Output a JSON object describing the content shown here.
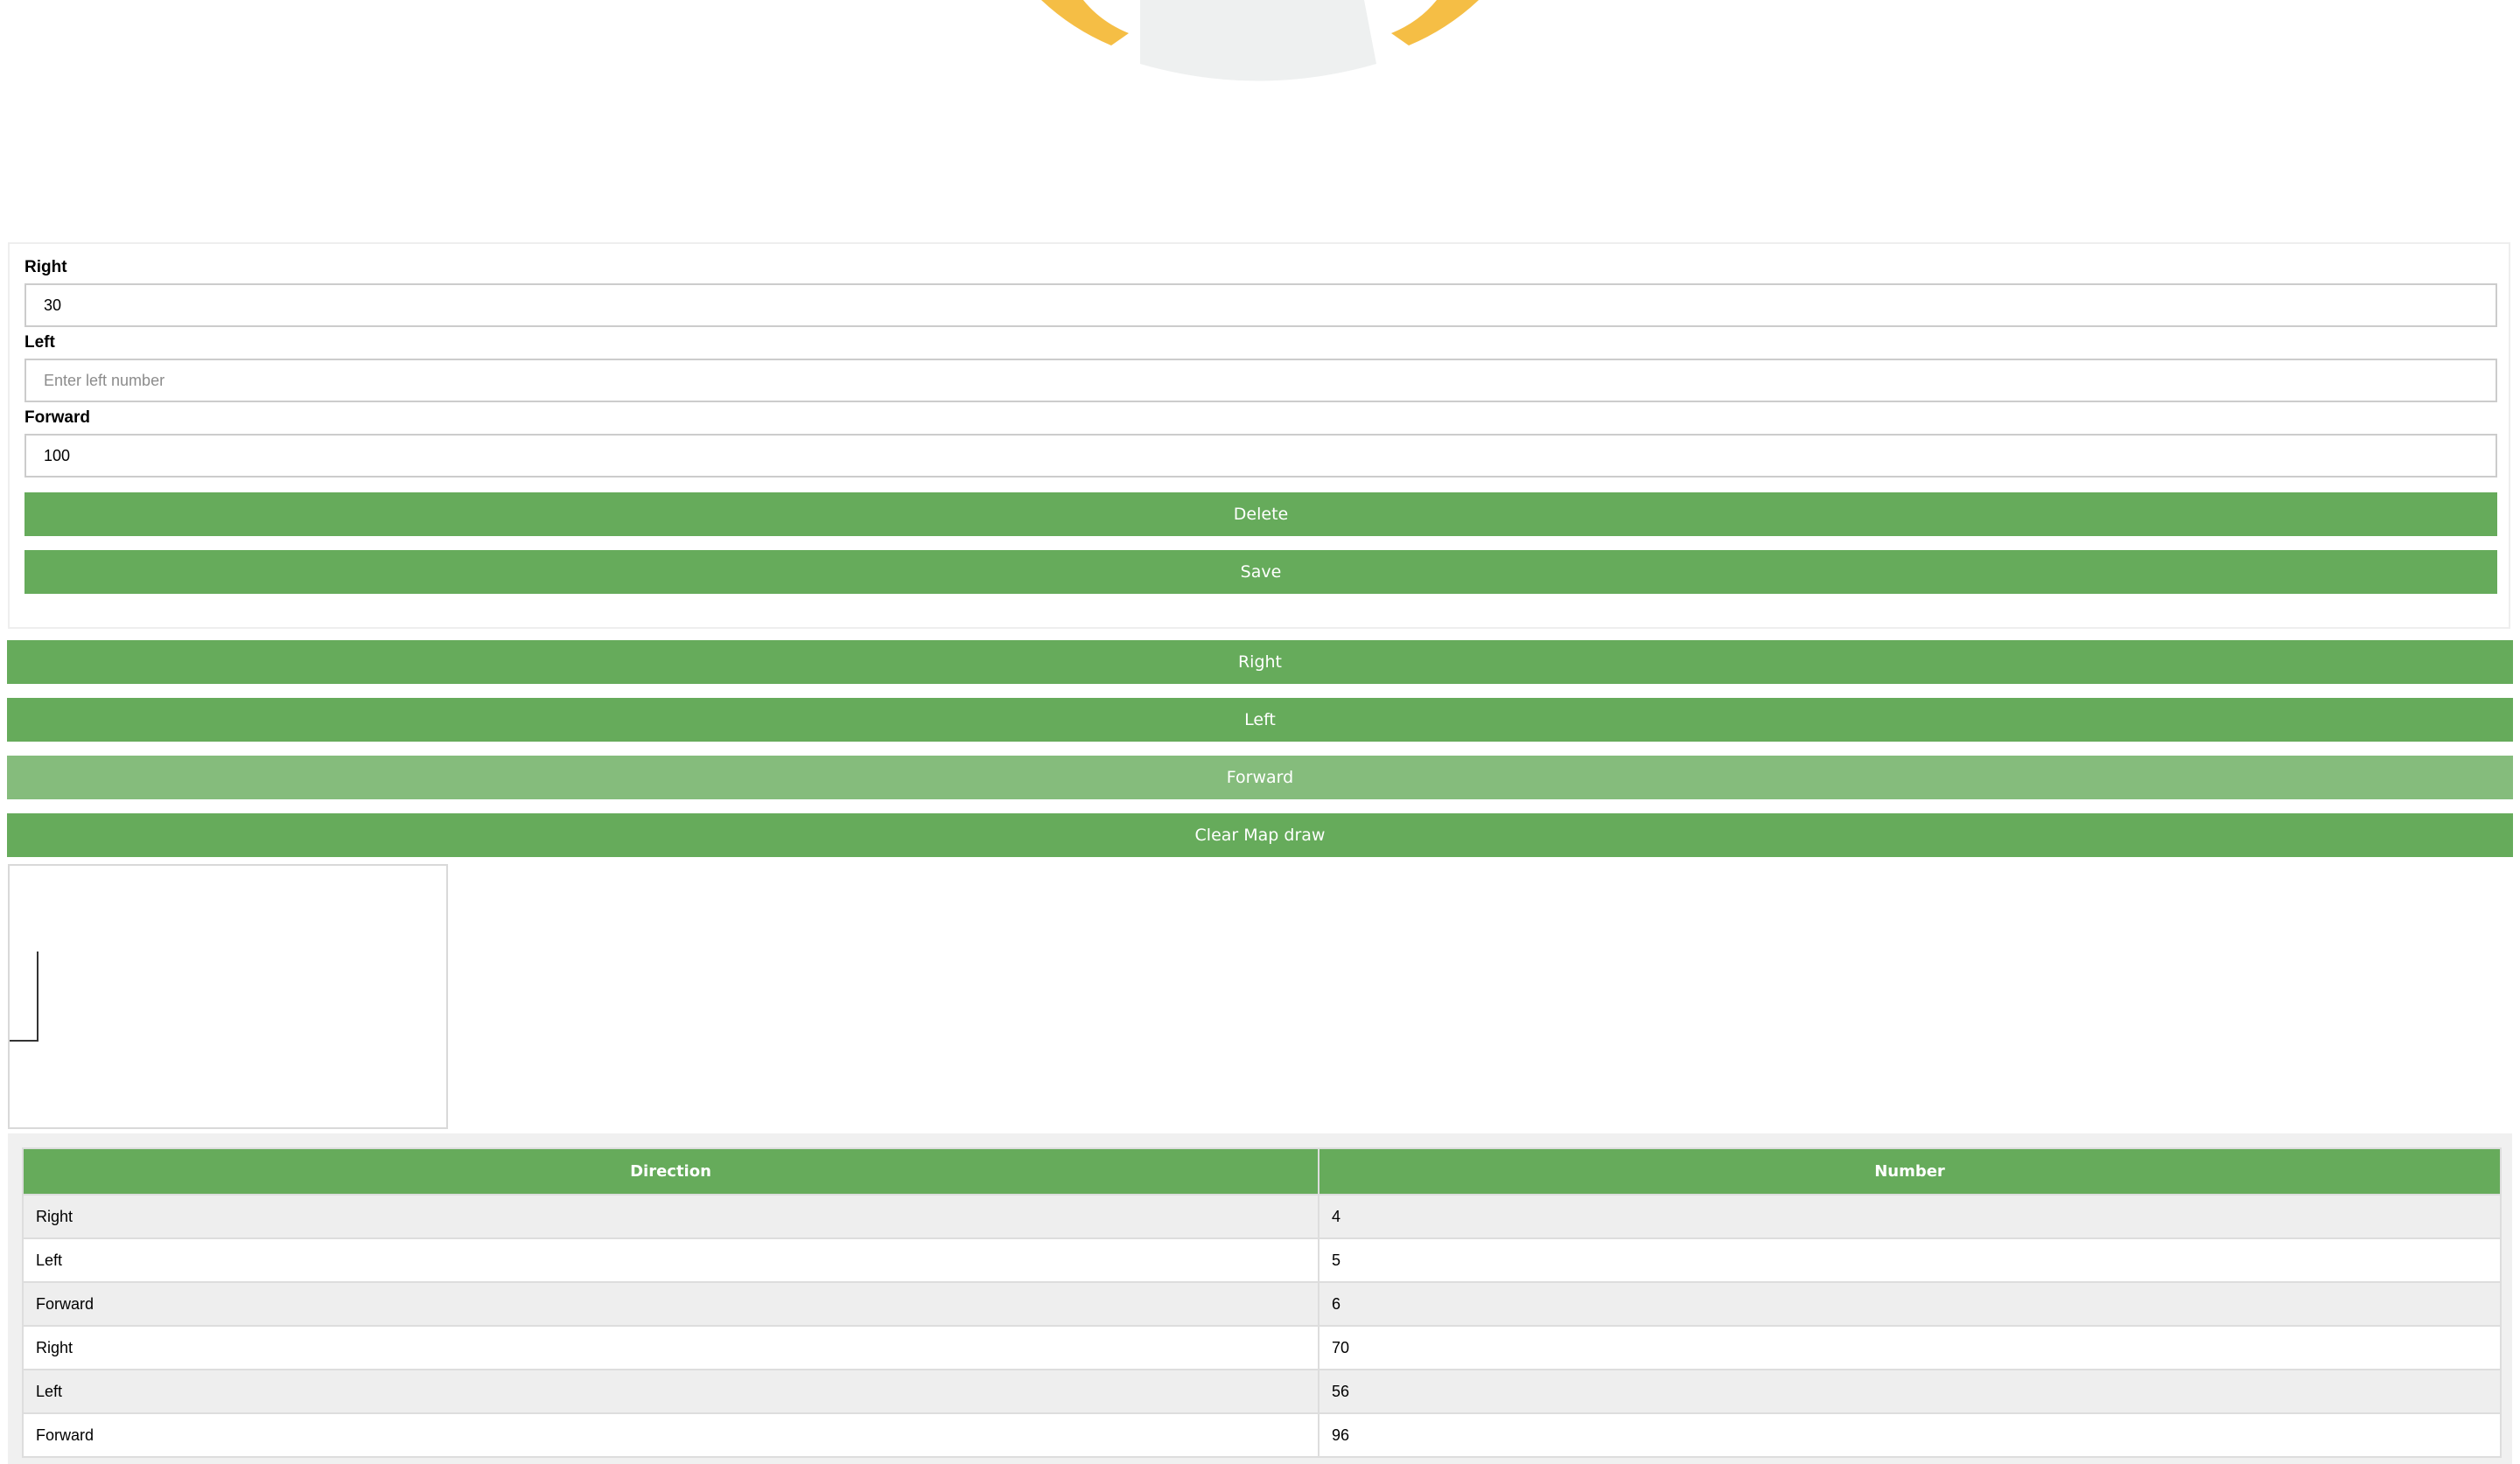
{
  "form": {
    "right_label": "Right",
    "right_value": "30",
    "left_label": "Left",
    "left_value": "",
    "left_placeholder": "Enter left number",
    "forward_label": "Forward",
    "forward_value": "100",
    "delete_label": "Delete",
    "save_label": "Save"
  },
  "controls": {
    "right_label": "Right",
    "left_label": "Left",
    "forward_label": "Forward",
    "clear_label": "Clear Map draw"
  },
  "table": {
    "headers": [
      "Direction",
      "Number"
    ],
    "rows": [
      {
        "direction": "Right",
        "number": "4"
      },
      {
        "direction": "Left",
        "number": "5"
      },
      {
        "direction": "Forward",
        "number": "6"
      },
      {
        "direction": "Right",
        "number": "70"
      },
      {
        "direction": "Left",
        "number": "56"
      },
      {
        "direction": "Forward",
        "number": "96"
      }
    ]
  },
  "colors": {
    "button_green": "#66ab5b",
    "button_green_active": "#85bc7c",
    "gauge_yellow": "#f5be45",
    "gauge_gray": "#eef0f0"
  }
}
